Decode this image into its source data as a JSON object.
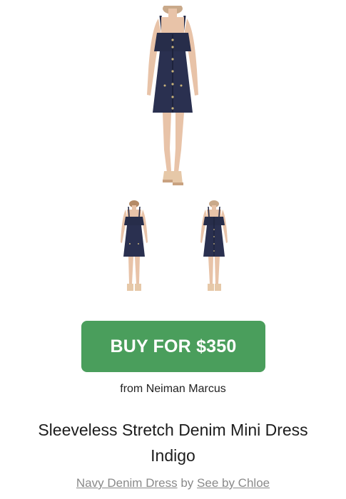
{
  "product": {
    "main_image_alt": "Sleeveless Stretch Denim Mini Dress Indigo",
    "thumbnails": [
      {
        "view": "back"
      },
      {
        "view": "front"
      }
    ],
    "buy_button_label": "BUY FOR $350",
    "retailer_line": "from Neiman Marcus",
    "title": "Sleeveless Stretch Denim Mini Dress Indigo",
    "category_link": "Navy Denim Dress",
    "by_word": "by",
    "brand_link": "See by Chloe"
  },
  "colors": {
    "buy_button": "#4a9e5c",
    "dress": "#272d4a",
    "meta_text": "#8a8a8a"
  },
  "icons": [
    "dress-photo-main",
    "dress-photo-back",
    "dress-photo-front"
  ]
}
